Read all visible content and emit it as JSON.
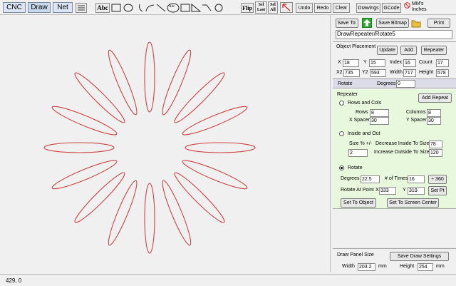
{
  "tabs": [
    "CNC",
    "Draw",
    "Net"
  ],
  "toolbar": {
    "text_tool": "Abc",
    "circle_text_tool": "Abc",
    "flip": "Flip",
    "sel_last_1": "Sel",
    "sel_last_2": "Last",
    "sel_all_1": "Sel",
    "sel_all_2": "All",
    "undo": "Undo",
    "redo": "Redo",
    "clear": "Clear",
    "drawings": "Drawings",
    "gcode": "GCode",
    "units_mm": "MM's",
    "units_in": "Inches"
  },
  "status": {
    "coords": "429, 0"
  },
  "panel": {
    "save_to": "Save To:",
    "save_bitmap": "Save Bitmap",
    "print": "Print",
    "drawing_name": "DrawRepeater/Rotate5",
    "object_placement": {
      "title": "Object Placement",
      "update": "Update",
      "add": "Add",
      "repeater": "Repeater",
      "x_label": "X",
      "x": "18",
      "y_label": "Y",
      "y": "15",
      "index_label": "Index",
      "index": "16",
      "count_label": "Count",
      "count": "17",
      "x2_label": "X2",
      "x2": "735",
      "y2_label": "Y2",
      "y2": "593",
      "width_label": "Width",
      "width": "717",
      "height_label": "Height",
      "height": "578"
    },
    "rotate_row": {
      "label": "Rotate",
      "degrees_label": "Degrees",
      "degrees": "0"
    },
    "repeater": {
      "title": "Repeater",
      "add_repeat": "Add Repeat",
      "rows_and_cols": "Rows and Cols",
      "rows_label": "Rows",
      "rows": "8",
      "columns_label": "Columns",
      "columns": "8",
      "xspacer_label": "X Spacer",
      "xspacer": "30",
      "yspacer_label": "Y Spacer",
      "yspacer": "30",
      "inside_out": "Inside and Out",
      "size_label": "Size % +/-",
      "size": "2",
      "dec_label": "Decrease Inside To Size %",
      "dec": "78",
      "inc_label": "Increase Outside To Size %",
      "inc": "120",
      "rotate": "Rotate",
      "degrees_label": "Degrees",
      "degrees": "22.5",
      "times_label": "# of Times",
      "times": "16",
      "plus360": "÷ 360",
      "rot_point_label": "Rotate At Point",
      "px_label": "X",
      "px": "333",
      "py_label": "Y",
      "py": "319",
      "set_pt": "Set Pt",
      "set_to_object": "Set To Object",
      "set_to_center": "Set To Screen Center"
    },
    "draw_panel": {
      "title": "Draw Panel Size",
      "save_settings": "Save Draw Settings",
      "width_label": "Width",
      "width": "203.2",
      "width_unit": "mm",
      "height_label": "Height",
      "height": "254",
      "height_unit": "mm"
    }
  },
  "colors": {
    "petal_stroke": "#cc4444",
    "repeater_bg": "#e8f8dc",
    "accent_green": "#33aa33"
  },
  "drawing": {
    "petal_count": 16,
    "rotate_step_degrees": 22.5
  }
}
